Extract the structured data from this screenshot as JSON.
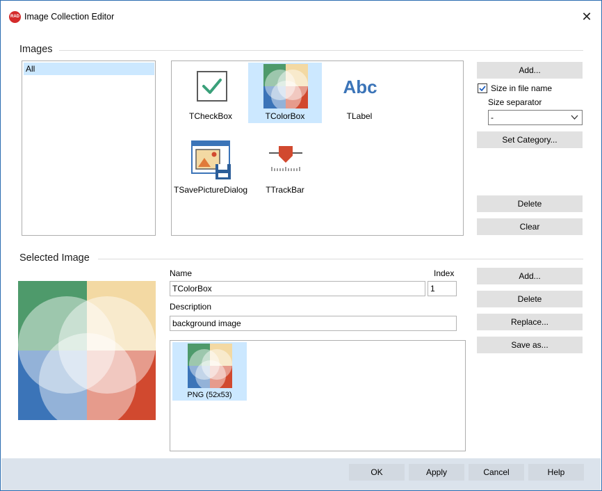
{
  "window": {
    "title": "Image Collection Editor",
    "app_icon_text": "RAD",
    "close_glyph": "✕"
  },
  "images_group": {
    "label": "Images",
    "categories": [
      "All"
    ],
    "items": [
      {
        "label": "TCheckBox",
        "icon": "checkbox-icon"
      },
      {
        "label": "TColorBox",
        "icon": "colorbox-icon",
        "selected": true
      },
      {
        "label": "TLabel",
        "icon": "label-abc-icon",
        "icon_text": "Abc"
      },
      {
        "label": "TSavePictureDialog",
        "icon": "save-picture-icon"
      },
      {
        "label": "TTrackBar",
        "icon": "trackbar-icon"
      }
    ],
    "buttons": {
      "add": "Add...",
      "set_category": "Set Category...",
      "delete": "Delete",
      "clear": "Clear"
    },
    "size_in_file_name": {
      "label": "Size in file name",
      "checked": true
    },
    "size_separator": {
      "label": "Size separator",
      "value": "-"
    }
  },
  "selected_group": {
    "label": "Selected Image",
    "name_label": "Name",
    "name_value": "TColorBox",
    "index_label": "Index",
    "index_value": "1",
    "description_label": "Description",
    "description_value": "background image",
    "variants": [
      {
        "label": "PNG (52x53)"
      }
    ],
    "buttons": {
      "add": "Add...",
      "delete": "Delete",
      "replace": "Replace...",
      "save_as": "Save as..."
    }
  },
  "footer": {
    "ok": "OK",
    "apply": "Apply",
    "cancel": "Cancel",
    "help": "Help"
  },
  "colors": {
    "selection": "#cce8ff",
    "button": "#e1e1e1",
    "footer": "#dbe3ec",
    "venn_green": "#4e9a6b",
    "venn_yellow": "#f3d9a3",
    "venn_blue": "#3b74b8",
    "venn_red": "#d1492f"
  }
}
